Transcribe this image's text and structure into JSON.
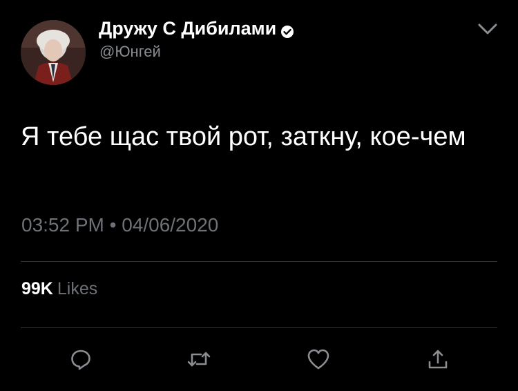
{
  "author": {
    "display_name": "Дружу С Дибилами",
    "handle": "@Юнгей",
    "verified_icon": "verified-badge-icon",
    "avatar_icon": "profile-photo"
  },
  "tweet": {
    "text": "Я тебе щас твой рот, заткну, кое-чем",
    "timestamp": "03:52 PM • 04/06/2020"
  },
  "stats": {
    "likes_count": "99K",
    "likes_label": "Likes"
  },
  "actions": {
    "reply_icon": "reply-icon",
    "retweet_icon": "retweet-icon",
    "like_icon": "heart-icon",
    "share_icon": "share-icon"
  },
  "colors": {
    "background": "#000000",
    "text": "#ffffff",
    "secondary_text": "#8a8d91",
    "divider": "#2f3336",
    "icon": "#8a8d91"
  }
}
